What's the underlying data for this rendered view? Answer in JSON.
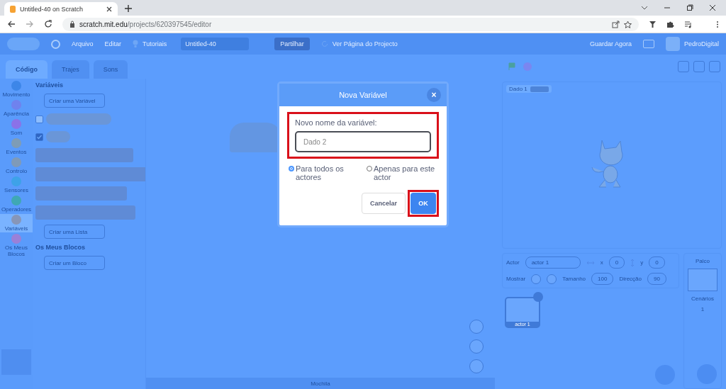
{
  "browser": {
    "tab_title": "Untitled-40 on Scratch",
    "url_host": "scratch.mit.edu",
    "url_path": "/projects/620397545/editor"
  },
  "menu_bar": {
    "items": [
      "Arquivo",
      "Editar"
    ],
    "tutorials": "Tutoriais",
    "project_title": "Untitled-40",
    "share_button": "Partilhar",
    "project_page": "Ver Página do Projecto",
    "save_now": "Guardar Agora",
    "username": "PedroDigital"
  },
  "editor_tabs": [
    {
      "label": "Código",
      "selected": true
    },
    {
      "label": "Trajes",
      "selected": false
    },
    {
      "label": "Sons",
      "selected": false
    }
  ],
  "categories": [
    {
      "label": "Movimento",
      "color": "#3d86e8",
      "selected": false
    },
    {
      "label": "Aparência",
      "color": "#6f82ee",
      "selected": false
    },
    {
      "label": "Som",
      "color": "#8a72e8",
      "selected": false
    },
    {
      "label": "Eventos",
      "color": "#7e9cb6",
      "selected": false
    },
    {
      "label": "Controlo",
      "color": "#7f9ab8",
      "selected": false
    },
    {
      "label": "Sensores",
      "color": "#3ea2e8",
      "selected": false
    },
    {
      "label": "Operadores",
      "color": "#3fa8b4",
      "selected": false
    },
    {
      "label": "Variáveis",
      "color": "#8796b8",
      "selected": true
    },
    {
      "label": "Os Meus Blocos",
      "color": "#9a80d8",
      "selected": false
    }
  ],
  "palette": {
    "heading": "Variáveis",
    "make_variable": "Criar uma Variável",
    "variables": [
      {
        "checked": false
      },
      {
        "checked": true
      }
    ],
    "make_list": "Criar uma Lista",
    "my_blocks_heading": "Os Meus Blocos",
    "make_block": "Criar um Bloco"
  },
  "stage": {
    "monitor": {
      "label": "Dado 1"
    }
  },
  "sprite_info": {
    "sprite_label": "Actor",
    "sprite_name": "actor 1",
    "x_label": "x",
    "x_value": "0",
    "y_label": "y",
    "y_value": "0",
    "show_label": "Mostrar",
    "size_label": "Tamanho",
    "size_value": "100",
    "direction_label": "Direcção",
    "direction_value": "90"
  },
  "sprites": [
    {
      "name": "actor 1",
      "selected": true
    }
  ],
  "stage_panel": {
    "title": "Palco",
    "backdrops_label": "Cenários",
    "backdrops_count": "1"
  },
  "backpack": "Mochila",
  "dialog": {
    "title": "Nova Variável",
    "close": "×",
    "field_label": "Novo nome da variável:",
    "placeholder": "Dado 2",
    "scopes": [
      {
        "label": "Para todos os actores",
        "selected": true
      },
      {
        "label": "Apenas para este actor",
        "selected": false
      }
    ],
    "buttons": [
      {
        "label": "Cancelar",
        "kind": "secondary"
      },
      {
        "label": "OK",
        "kind": "primary"
      }
    ]
  }
}
